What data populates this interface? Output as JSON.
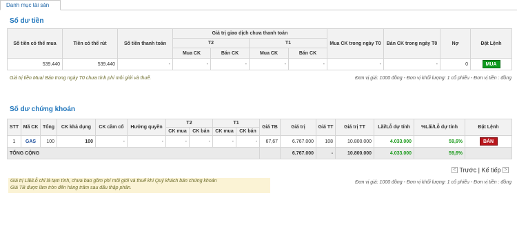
{
  "tab": {
    "label": "Danh mục tài sản"
  },
  "cash": {
    "title": "Số dư tiền",
    "headers": {
      "buyable": "Số tiền có thể mua",
      "withdrawable": "Tiền có thể rút",
      "payment": "Số tiền thanh toán",
      "pending_group": "Giá trị giao dịch chưa thanh toán",
      "t2": "T2",
      "t1": "T1",
      "buy_ck": "Mua CK",
      "sell_ck": "Bán CK",
      "buy_t0": "Mua CK trong ngày T0",
      "sell_t0": "Bán CK trong ngày T0",
      "debt": "Nợ",
      "order": "Đặt Lệnh"
    },
    "row": {
      "buyable": "539.440",
      "withdrawable": "539.440",
      "payment": "-",
      "t2_buy": "-",
      "t2_sell": "-",
      "t1_buy": "-",
      "t1_sell": "-",
      "buy_t0": "-",
      "sell_t0": "-",
      "debt": "0",
      "button": "MUA"
    },
    "note_left": "Giá trị tiền Mua/ Bán trong ngày T0 chưa tính phí môi giới và thuế.",
    "note_right": "Đơn vị giá: 1000 đồng - Đơn vị khối lượng: 1 cổ phiếu - Đơn vị tiền : đồng"
  },
  "stocks": {
    "title": "Số dư chứng khoán",
    "headers": {
      "stt": "STT",
      "code": "Mã CK",
      "total": "Tổng",
      "available": "CK khả dụng",
      "mortgaged": "CK cầm cố",
      "rights": "Hưởng quyền",
      "t2": "T2",
      "t1": "T1",
      "ck_buy": "CK mua",
      "ck_sell": "CK bán",
      "avg_price": "Giá TB",
      "value": "Giá trị",
      "market_price": "Giá TT",
      "market_value": "Giá trị TT",
      "pl": "Lãi/Lỗ dự tính",
      "pl_pct": "%Lãi/Lỗ dự tính",
      "order": "Đặt Lệnh"
    },
    "rows": [
      {
        "stt": "1",
        "code": "GAS",
        "total": "100",
        "available": "100",
        "mortgaged": "-",
        "rights": "-",
        "t2_buy": "-",
        "t2_sell": "-",
        "t1_buy": "-",
        "t1_sell": "-",
        "avg_price": "67,67",
        "value": "6.767.000",
        "market_price": "108",
        "market_value": "10.800.000",
        "pl": "4.033.000",
        "pl_pct": "59,6%",
        "button": "BÁN"
      }
    ],
    "total_row": {
      "label": "TỔNG CỘNG",
      "value": "6.767.000",
      "market_price": "-",
      "market_value": "10.800.000",
      "pl": "4.033.000",
      "pl_pct": "59,6%"
    },
    "pager": {
      "prev": "Trước",
      "separator": "|",
      "next": "Kế tiếp"
    },
    "footnote": [
      "Giá trị Lãi/Lỗ chỉ là tạm tính, chưa bao gồm phí môi giới và thuế khi Quý khách bán chứng khoán",
      "Giá TB được làm tròn đến hàng trăm sau dấu thập phân."
    ],
    "note_right": "Đơn vị giá: 1000 đồng - Đơn vị khối lượng: 1 cổ phiếu - Đơn vị tiền : đồng"
  },
  "colors": {
    "accent": "#1d74bb",
    "buy": "#0d9a1d",
    "sell": "#b8151b",
    "profit": "#1a9a1a"
  }
}
